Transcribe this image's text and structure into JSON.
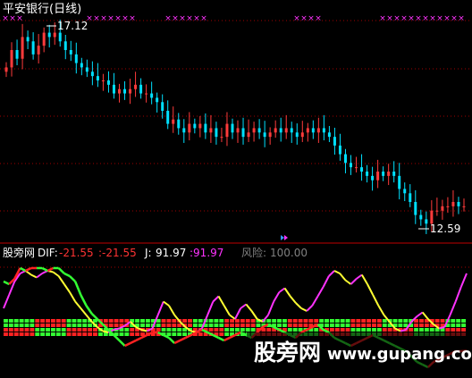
{
  "upper_panel": {
    "title": "平安银行(日线)",
    "high_label": "17.12",
    "low_label": "12.59",
    "marker_colors": [
      "#ff33ff",
      "#3399ff"
    ]
  },
  "lower_panel": {
    "name": "股旁网",
    "dif_label": "DIF:",
    "dif_value": "-21.55",
    "dif_value2": ":-21.55",
    "j_label": "J:",
    "j_value": "91.97",
    "j_value2": ":91.97",
    "risk_label": "风险:",
    "risk_value": "100.00"
  },
  "watermark": {
    "cn": "股旁网",
    "url": "www.gupang.com"
  },
  "colors": {
    "background": "#000000",
    "up": "#ff3b3b",
    "down": "#00e0ff",
    "title": "#ffffff",
    "grid": "#a00000",
    "dif_label": "#ffffff",
    "dif": "#ff3333",
    "j": "#ffffff",
    "j_value": "#ff33ff",
    "risk": "#808080",
    "magenta": "#ff33ff",
    "yellow": "#ffff33",
    "green": "#33ff33",
    "red": "#ff2222"
  },
  "chart_data": {
    "type": "candlestick",
    "price_high": 17.12,
    "price_low": 12.59,
    "price_series": [
      16.2,
      16.6,
      16.4,
      16.9,
      16.8,
      16.5,
      16.7,
      17.0,
      16.9,
      17.0,
      16.8,
      16.6,
      16.5,
      16.3,
      16.2,
      16.1,
      16.0,
      15.9,
      15.9,
      15.8,
      15.6,
      15.7,
      15.6,
      15.7,
      15.8,
      15.6,
      15.6,
      15.5,
      15.4,
      15.2,
      14.9,
      15.0,
      14.8,
      14.7,
      14.9,
      14.8,
      14.9,
      14.7,
      14.8,
      14.6,
      14.6,
      14.9,
      14.7,
      14.8,
      14.6,
      14.7,
      14.8,
      14.7,
      14.6,
      14.7,
      14.8,
      14.7,
      14.8,
      14.7,
      14.6,
      14.7,
      14.8,
      14.7,
      14.8,
      14.7,
      14.6,
      14.4,
      14.2,
      14.0,
      13.9,
      13.9,
      13.8,
      13.7,
      13.6,
      13.8,
      13.7,
      13.8,
      13.7,
      13.4,
      13.3,
      13.1,
      12.8,
      12.7,
      12.6,
      12.9,
      12.9,
      13.0,
      13.0,
      13.1,
      13.0,
      13.0
    ],
    "indicator_series": {
      "dif": [
        30,
        28,
        32,
        40,
        38,
        42,
        44,
        40,
        38,
        42,
        40,
        36,
        34,
        30,
        20,
        12,
        6,
        2,
        -2,
        -6,
        -10,
        -14,
        -18,
        -16,
        -14,
        -12,
        -10,
        -8,
        -8,
        -10,
        -12,
        -16,
        -14,
        -12,
        -10,
        -8,
        -6,
        -8,
        -10,
        -12,
        -14,
        -12,
        -10,
        -8,
        -10,
        -12,
        -8,
        -4,
        -2,
        -4,
        -6,
        -8,
        -10,
        -12,
        -8,
        -6,
        -4,
        -2,
        -6,
        -8,
        -12,
        -14,
        -16,
        -18,
        -16,
        -14,
        -12,
        -10,
        -12,
        -14,
        -16,
        -18,
        -20,
        -22,
        -26,
        -30,
        -32,
        -34,
        -30,
        -28,
        -26,
        -24,
        -22,
        -22,
        -21.55
      ],
      "j": [
        40,
        60,
        80,
        92,
        96,
        90,
        86,
        92,
        96,
        94,
        88,
        76,
        64,
        50,
        40,
        30,
        20,
        12,
        6,
        4,
        8,
        10,
        14,
        20,
        12,
        8,
        6,
        10,
        30,
        50,
        44,
        30,
        20,
        12,
        6,
        4,
        10,
        30,
        50,
        58,
        44,
        30,
        24,
        40,
        46,
        36,
        24,
        20,
        30,
        50,
        64,
        70,
        58,
        48,
        40,
        36,
        44,
        58,
        72,
        88,
        96,
        92,
        82,
        76,
        84,
        90,
        76,
        60,
        44,
        30,
        20,
        10,
        6,
        8,
        20,
        28,
        34,
        24,
        16,
        10,
        12,
        30,
        50,
        72,
        91.97
      ],
      "risk": 100
    }
  }
}
